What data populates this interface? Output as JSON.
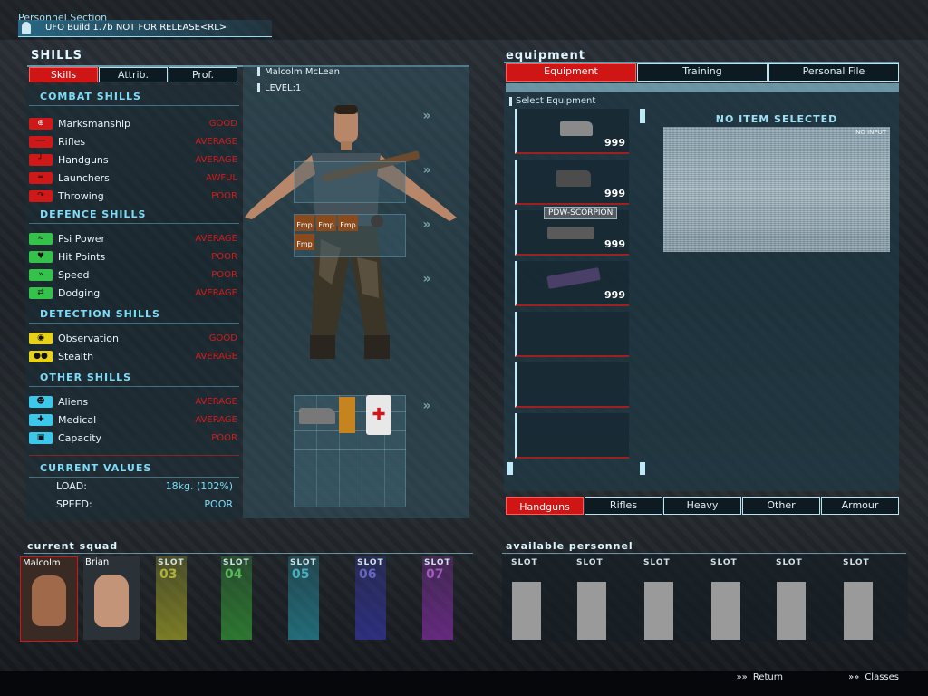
{
  "top": {
    "section": "Personnel Section",
    "build": "UFO Build 1.7b NOT FOR RELEASE<RL>"
  },
  "skills_panel": {
    "title": "SHILLS",
    "tabs": [
      "Skills",
      "Attrib.",
      "Prof."
    ],
    "categories": {
      "combat": "COMBAT SHILLS",
      "defence": "DEFENCE SHILLS",
      "detection": "DETECTION SHILLS",
      "other": "OTHER SHILLS",
      "current": "CURRENT VALUES"
    },
    "combat": [
      {
        "name": "Marksmanship",
        "value": "GOOD",
        "icon": "crosshair-icon",
        "color": "#d01818"
      },
      {
        "name": "Rifles",
        "value": "AVERAGE",
        "icon": "rifle-icon",
        "color": "#d01818"
      },
      {
        "name": "Handguns",
        "value": "AVERAGE",
        "icon": "handgun-icon",
        "color": "#d01818"
      },
      {
        "name": "Launchers",
        "value": "AWFUL",
        "icon": "launcher-icon",
        "color": "#d01818"
      },
      {
        "name": "Throwing",
        "value": "POOR",
        "icon": "throwing-icon",
        "color": "#d01818"
      }
    ],
    "defence": [
      {
        "name": "Psi Power",
        "value": "AVERAGE",
        "icon": "psi-icon",
        "color": "#35c24a"
      },
      {
        "name": "Hit Points",
        "value": "POOR",
        "icon": "heart-icon",
        "color": "#35c24a"
      },
      {
        "name": "Speed",
        "value": "POOR",
        "icon": "runner-icon",
        "color": "#35c24a"
      },
      {
        "name": "Dodging",
        "value": "AVERAGE",
        "icon": "dodge-icon",
        "color": "#35c24a"
      }
    ],
    "detection": [
      {
        "name": "Observation",
        "value": "GOOD",
        "icon": "eye-icon",
        "color": "#e8d219"
      },
      {
        "name": "Stealth",
        "value": "AVERAGE",
        "icon": "mask-icon",
        "color": "#e8d219"
      }
    ],
    "other": [
      {
        "name": "Aliens",
        "value": "AVERAGE",
        "icon": "alien-icon",
        "color": "#3cc8ea"
      },
      {
        "name": "Medical",
        "value": "AVERAGE",
        "icon": "medical-icon",
        "color": "#3cc8ea"
      },
      {
        "name": "Capacity",
        "value": "POOR",
        "icon": "briefcase-icon",
        "color": "#3cc8ea"
      }
    ],
    "current": [
      {
        "label": "LOAD:",
        "value": "18kg. (102%)"
      },
      {
        "label": "SPEED:",
        "value": "POOR"
      }
    ]
  },
  "soldier": {
    "name": "Malcolm McLean",
    "level": "LEVEL:1",
    "ammo_label": "Fmp"
  },
  "equipment_panel": {
    "title": "equipment",
    "tabs": [
      "Equipment",
      "Training",
      "Personal File"
    ],
    "select_label": "Select Equipment",
    "no_item": "NO ITEM SELECTED",
    "preview_tag": "NO INPUT",
    "tooltip": "PDW-SCORPION",
    "items": [
      {
        "count": "999",
        "icon": "pistol-icon"
      },
      {
        "count": "999",
        "icon": "pistol-icon"
      },
      {
        "count": "999",
        "icon": "smg-icon"
      },
      {
        "count": "999",
        "icon": "smg-icon"
      },
      {
        "count": "",
        "icon": ""
      },
      {
        "count": "",
        "icon": ""
      },
      {
        "count": "",
        "icon": ""
      }
    ],
    "bottom_tabs": [
      "Handguns",
      "Rifles",
      "Heavy",
      "Other",
      "Armour"
    ]
  },
  "squad": {
    "title": "current squad",
    "members": [
      "Malcolm",
      "Brian"
    ],
    "slot_word": "SLOT",
    "slot_numbers": [
      "03",
      "04",
      "05",
      "06",
      "07"
    ]
  },
  "available": {
    "title": "available personnel",
    "slot_word": "SLOT"
  },
  "footer": {
    "return_label": "Return",
    "classes_label": "Classes"
  },
  "colors": {
    "accent": "#d01515",
    "panel_text": "#7fdcf8",
    "skill_value": "#d11c1c"
  }
}
